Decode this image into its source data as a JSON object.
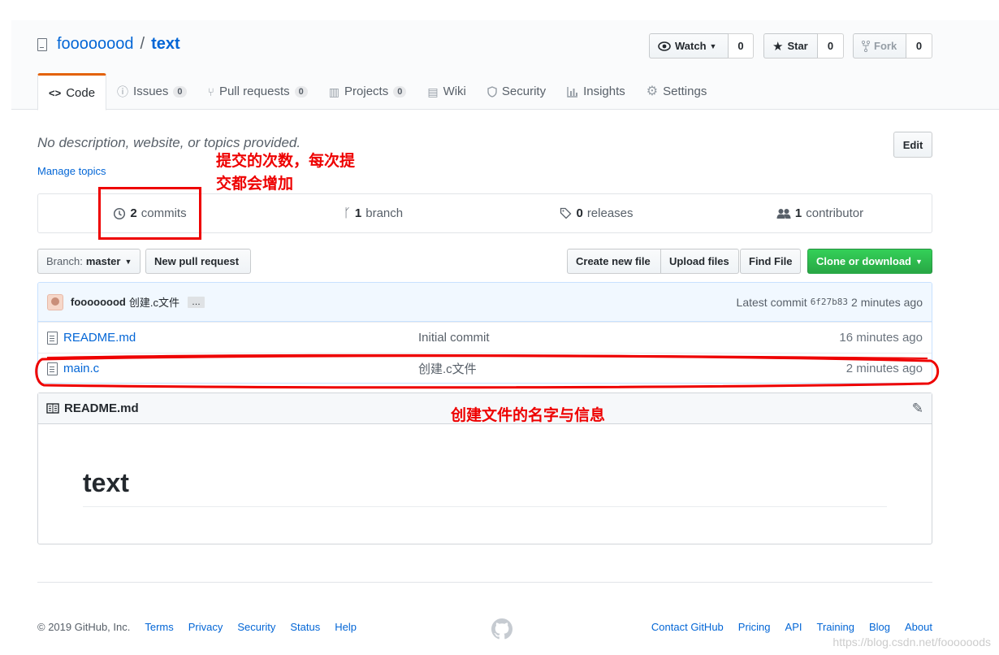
{
  "repo": {
    "owner": "foooooood",
    "separator": "/",
    "name": "text"
  },
  "actions": {
    "watch_label": "Watch",
    "watch_count": "0",
    "star_label": "Star",
    "star_count": "0",
    "fork_label": "Fork",
    "fork_count": "0"
  },
  "tabs": [
    {
      "label": "Code",
      "icon": "code-icon"
    },
    {
      "label": "Issues",
      "count": "0",
      "icon": "issue-icon"
    },
    {
      "label": "Pull requests",
      "count": "0",
      "icon": "pull-request-icon"
    },
    {
      "label": "Projects",
      "count": "0",
      "icon": "project-icon"
    },
    {
      "label": "Wiki",
      "icon": "book-icon"
    },
    {
      "label": "Security",
      "icon": "shield-icon"
    },
    {
      "label": "Insights",
      "icon": "graph-icon"
    },
    {
      "label": "Settings",
      "icon": "gear-icon"
    }
  ],
  "description": "No description, website, or topics provided.",
  "manage_topics": "Manage topics",
  "edit_label": "Edit",
  "annotations": {
    "commits_note_line1": "提交的次数，每次提",
    "commits_note_line2": "交都会增加",
    "file_note": "创建文件的名字与信息",
    "color": "#e00000"
  },
  "numbers": {
    "commits_num": "2",
    "commits_label": "commits",
    "branch_num": "1",
    "branch_label": "branch",
    "releases_num": "0",
    "releases_label": "releases",
    "contributor_num": "1",
    "contributor_label": "contributor"
  },
  "toolbar": {
    "branch_prefix": "Branch:",
    "branch_name": "master",
    "new_pr": "New pull request",
    "create_file": "Create new file",
    "upload_files": "Upload files",
    "find_file": "Find File",
    "clone": "Clone or download"
  },
  "latest_commit": {
    "author": "foooooood",
    "message": "创建.c文件",
    "ellipsis": "…",
    "prefix": "Latest commit",
    "sha": "6f27b83",
    "age": "2 minutes ago"
  },
  "files": [
    {
      "name": "README.md",
      "message": "Initial commit",
      "age": "16 minutes ago"
    },
    {
      "name": "main.c",
      "message": "创建.c文件",
      "age": "2 minutes ago"
    }
  ],
  "readme": {
    "filename": "README.md",
    "heading": "text"
  },
  "footer": {
    "copyright": "© 2019 GitHub, Inc.",
    "left_links": [
      "Terms",
      "Privacy",
      "Security",
      "Status",
      "Help"
    ],
    "right_links": [
      "Contact GitHub",
      "Pricing",
      "API",
      "Training",
      "Blog",
      "About"
    ]
  },
  "watermark": "https://blog.csdn.net/foooooods",
  "colors": {
    "link": "#0366d6",
    "clone_green": "#28a745",
    "active_tab": "#e36209"
  }
}
